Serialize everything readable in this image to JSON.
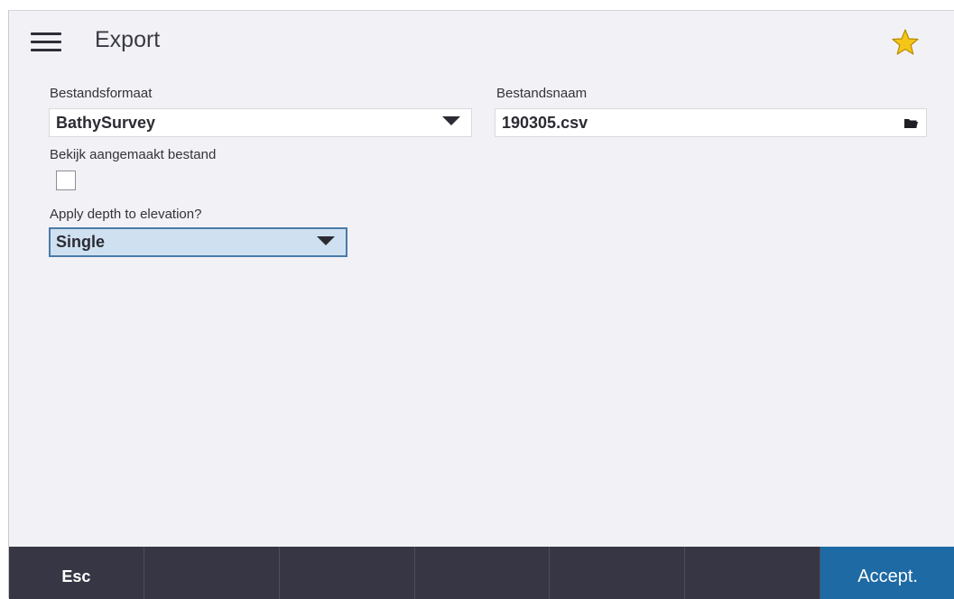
{
  "header": {
    "title": "Export"
  },
  "icons": {
    "menu": "hamburger-menu-icon",
    "favorite": "star-icon",
    "browse": "folder-icon"
  },
  "colors": {
    "background": "#f2f2f6",
    "footer": "#363645",
    "accent": "#1d6aa5",
    "star": "#f5c518",
    "focus_fill": "#cfe1f0",
    "focus_border": "#4a7ba8"
  },
  "form": {
    "file_format": {
      "label": "Bestandsformaat",
      "value": "BathySurvey"
    },
    "file_name": {
      "label": "Bestandsnaam",
      "value": "190305.csv"
    },
    "view_created_file": {
      "label": "Bekijk aangemaakt bestand",
      "checked": false
    },
    "apply_depth": {
      "label": "Apply depth to elevation?",
      "value": "Single"
    }
  },
  "footer": {
    "esc_label": "Esc",
    "accept_label": "Accept."
  }
}
